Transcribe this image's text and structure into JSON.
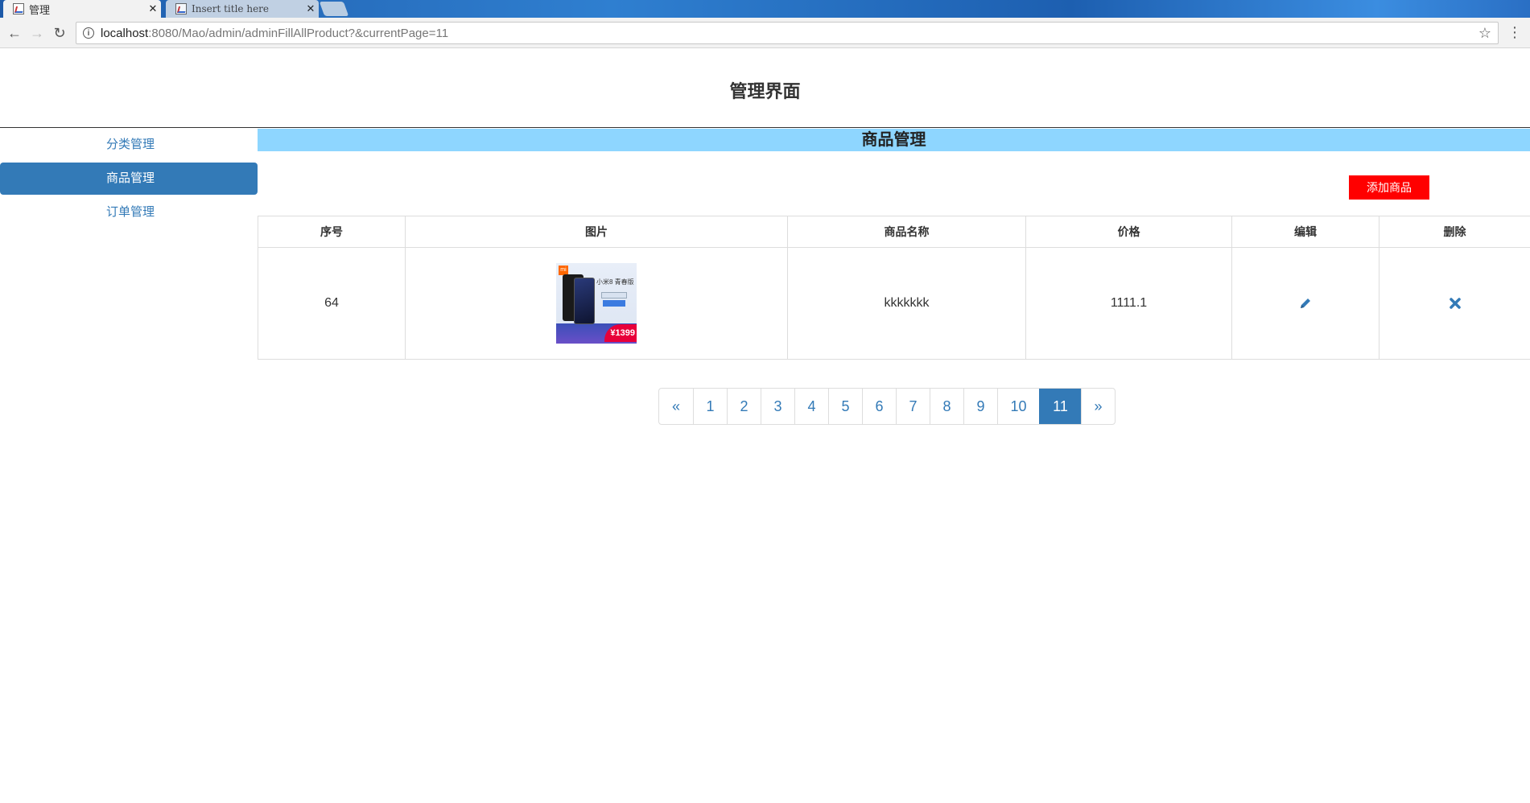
{
  "browser": {
    "tabs": [
      {
        "title": "管理",
        "active": true
      },
      {
        "title": "Insert title here",
        "active": false
      }
    ],
    "url_host": "localhost",
    "url_path": ":8080/Mao/admin/adminFillAllProduct?&currentPage=11"
  },
  "header": {
    "title": "管理界面"
  },
  "sidebar": {
    "items": [
      {
        "label": "分类管理",
        "active": false
      },
      {
        "label": "商品管理",
        "active": true
      },
      {
        "label": "订单管理",
        "active": false
      }
    ]
  },
  "main": {
    "section_title": "商品管理",
    "add_button": "添加商品",
    "table": {
      "columns": [
        "序号",
        "图片",
        "商品名称",
        "价格",
        "编辑",
        "删除"
      ],
      "rows": [
        {
          "id": "64",
          "image_alt": "product-image",
          "image_text": {
            "title": "小米8 青春版",
            "price": "¥1399"
          },
          "name": "kkkkkkk",
          "price": "1111.1"
        }
      ]
    },
    "pagination": {
      "prev": "«",
      "pages": [
        "1",
        "2",
        "3",
        "4",
        "5",
        "6",
        "7",
        "8",
        "9",
        "10",
        "11"
      ],
      "current": "11",
      "next": "»"
    }
  },
  "colors": {
    "accent": "#337ab7",
    "section_bar": "#8ed6ff",
    "add_button": "#ff0000"
  }
}
